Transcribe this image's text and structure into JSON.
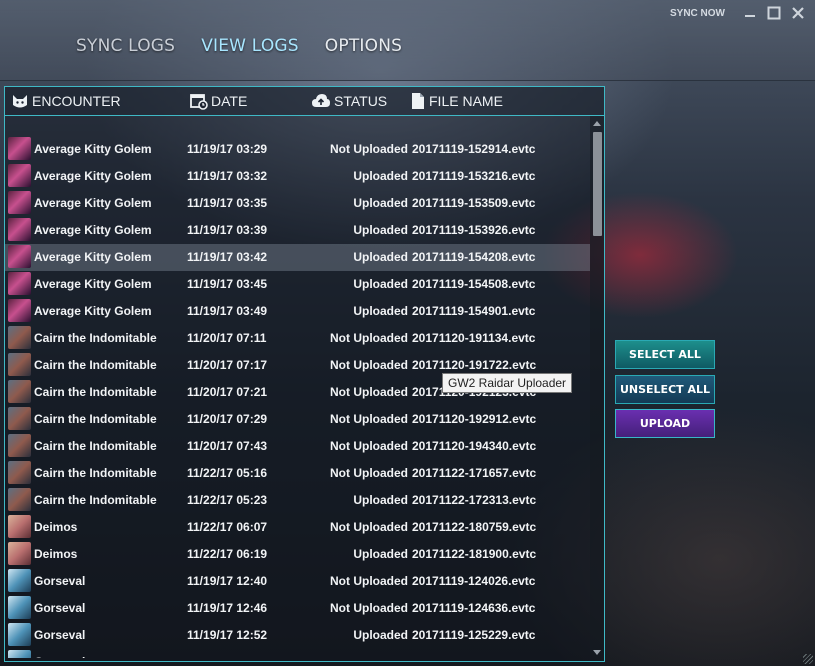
{
  "nav": {
    "sync_logs": "SYNC LOGS",
    "view_logs": "VIEW LOGS",
    "options": "OPTIONS"
  },
  "window": {
    "sync_now": "SYNC NOW",
    "minimize_icon": "minimize-icon",
    "maximize_icon": "maximize-icon",
    "close_icon": "close-icon"
  },
  "table": {
    "headers": {
      "encounter": "ENCOUNTER",
      "date": "DATE",
      "status": "STATUS",
      "file_name": "FILE NAME"
    },
    "selected_row": 4,
    "rows": [
      {
        "encounter": "Average Kitty Golem",
        "date": "11/19/17 03:29",
        "status": "Not Uploaded",
        "file": "20171119-152914.evtc"
      },
      {
        "encounter": "Average Kitty Golem",
        "date": "11/19/17 03:32",
        "status": "Uploaded",
        "file": "20171119-153216.evtc"
      },
      {
        "encounter": "Average Kitty Golem",
        "date": "11/19/17 03:35",
        "status": "Uploaded",
        "file": "20171119-153509.evtc"
      },
      {
        "encounter": "Average Kitty Golem",
        "date": "11/19/17 03:39",
        "status": "Uploaded",
        "file": "20171119-153926.evtc"
      },
      {
        "encounter": "Average Kitty Golem",
        "date": "11/19/17 03:42",
        "status": "Uploaded",
        "file": "20171119-154208.evtc"
      },
      {
        "encounter": "Average Kitty Golem",
        "date": "11/19/17 03:45",
        "status": "Uploaded",
        "file": "20171119-154508.evtc"
      },
      {
        "encounter": "Average Kitty Golem",
        "date": "11/19/17 03:49",
        "status": "Uploaded",
        "file": "20171119-154901.evtc"
      },
      {
        "encounter": "Cairn the Indomitable",
        "date": "11/20/17 07:11",
        "status": "Not Uploaded",
        "file": "20171120-191134.evtc"
      },
      {
        "encounter": "Cairn the Indomitable",
        "date": "11/20/17 07:17",
        "status": "Not Uploaded",
        "file": "20171120-191722.evtc"
      },
      {
        "encounter": "Cairn the Indomitable",
        "date": "11/20/17 07:21",
        "status": "Not Uploaded",
        "file": "20171120-192123.evtc"
      },
      {
        "encounter": "Cairn the Indomitable",
        "date": "11/20/17 07:29",
        "status": "Not Uploaded",
        "file": "20171120-192912.evtc"
      },
      {
        "encounter": "Cairn the Indomitable",
        "date": "11/20/17 07:43",
        "status": "Not Uploaded",
        "file": "20171120-194340.evtc"
      },
      {
        "encounter": "Cairn the Indomitable",
        "date": "11/22/17 05:16",
        "status": "Not Uploaded",
        "file": "20171122-171657.evtc"
      },
      {
        "encounter": "Cairn the Indomitable",
        "date": "11/22/17 05:23",
        "status": "Uploaded",
        "file": "20171122-172313.evtc"
      },
      {
        "encounter": "Deimos",
        "date": "11/22/17 06:07",
        "status": "Not Uploaded",
        "file": "20171122-180759.evtc"
      },
      {
        "encounter": "Deimos",
        "date": "11/22/17 06:19",
        "status": "Uploaded",
        "file": "20171122-181900.evtc"
      },
      {
        "encounter": "Gorseval",
        "date": "11/19/17 12:40",
        "status": "Not Uploaded",
        "file": "20171119-124026.evtc"
      },
      {
        "encounter": "Gorseval",
        "date": "11/19/17 12:46",
        "status": "Not Uploaded",
        "file": "20171119-124636.evtc"
      },
      {
        "encounter": "Gorseval",
        "date": "11/19/17 12:52",
        "status": "Uploaded",
        "file": "20171119-125229.evtc"
      },
      {
        "encounter": "Gorseval",
        "date": "",
        "status": "",
        "file": ""
      }
    ]
  },
  "tooltip": "GW2 Raidar Uploader",
  "buttons": {
    "select_all": "SELECT ALL",
    "unselect_all": "UNSELECT ALL",
    "upload": "UPLOAD"
  },
  "colors": {
    "accent": "#3fb9c6",
    "upload_button": "#5a28a0",
    "select_button": "#1d8f8c",
    "active_tab": "#a8e6ff"
  }
}
